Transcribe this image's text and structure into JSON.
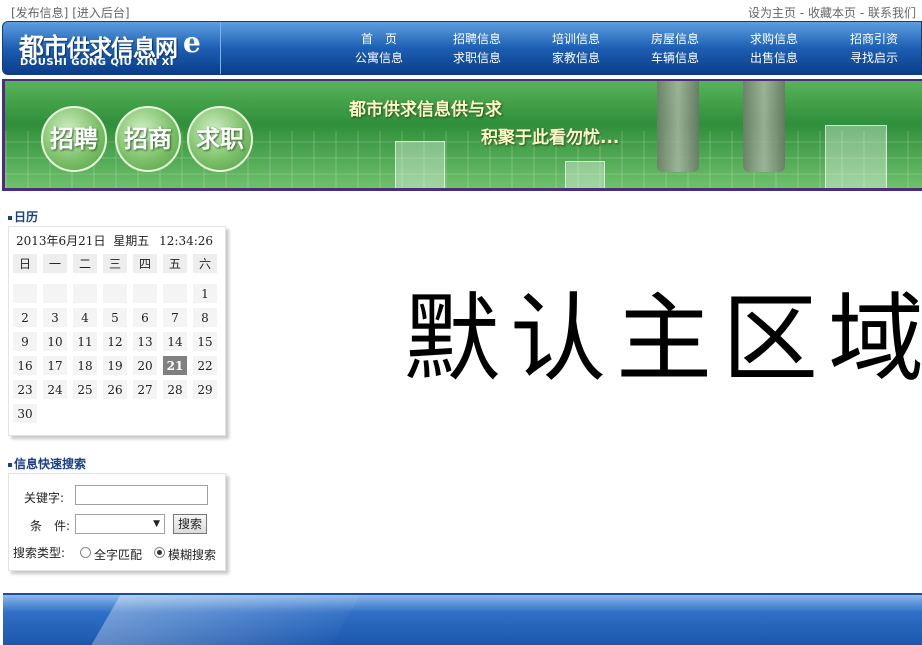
{
  "topbar": {
    "publish": "[发布信息]",
    "backend": "[进入后台]",
    "set_home": "设为主页",
    "sep1": " - ",
    "bookmark": "收藏本页",
    "sep2": " - ",
    "contact": "联系我们"
  },
  "logo": {
    "cn_big": "都市",
    "cn_rest": "供求信息网",
    "e": "e",
    "en": "DOUSHI  GONG QIU XIN XI"
  },
  "nav": {
    "columns": [
      {
        "top": "首　页",
        "bottom": "公寓信息"
      },
      {
        "top": "招聘信息",
        "bottom": "求职信息"
      },
      {
        "top": "培训信息",
        "bottom": "家教信息"
      },
      {
        "top": "房屋信息",
        "bottom": "车辆信息"
      },
      {
        "top": "求购信息",
        "bottom": "出售信息"
      },
      {
        "top": "招商引资",
        "bottom": "寻找启示"
      }
    ]
  },
  "banner": {
    "bubbles": [
      "招聘",
      "招商",
      "求职"
    ],
    "slogan_line1": "都市供求信息供与求",
    "slogan_line2": "积聚于此看勿忧..."
  },
  "calendar": {
    "section_title": "日历",
    "date_text": "2013年6月21日",
    "weekday_text": "星期五",
    "time_text": "12:34:26",
    "weekday_headers": [
      "日",
      "一",
      "二",
      "三",
      "四",
      "五",
      "六"
    ],
    "weeks": [
      [
        "",
        "",
        "",
        "",
        "",
        "",
        "1"
      ],
      [
        "2",
        "3",
        "4",
        "5",
        "6",
        "7",
        "8"
      ],
      [
        "9",
        "10",
        "11",
        "12",
        "13",
        "14",
        "15"
      ],
      [
        "16",
        "17",
        "18",
        "19",
        "20",
        "21",
        "22"
      ],
      [
        "23",
        "24",
        "25",
        "26",
        "27",
        "28",
        "29"
      ],
      [
        "30",
        "",
        "",
        "",
        "",
        "",
        ""
      ]
    ],
    "today": "21"
  },
  "search": {
    "section_title": "信息快速搜索",
    "keyword_label": "关键字:",
    "keyword_value": "",
    "condition_label": "条　件:",
    "condition_value": "",
    "search_button": "搜索",
    "type_label": "搜索类型:",
    "type_exact": "全字匹配",
    "type_fuzzy": "模糊搜索",
    "selected_type": "模糊搜索"
  },
  "main": {
    "placeholder_text": "默认主区域"
  }
}
